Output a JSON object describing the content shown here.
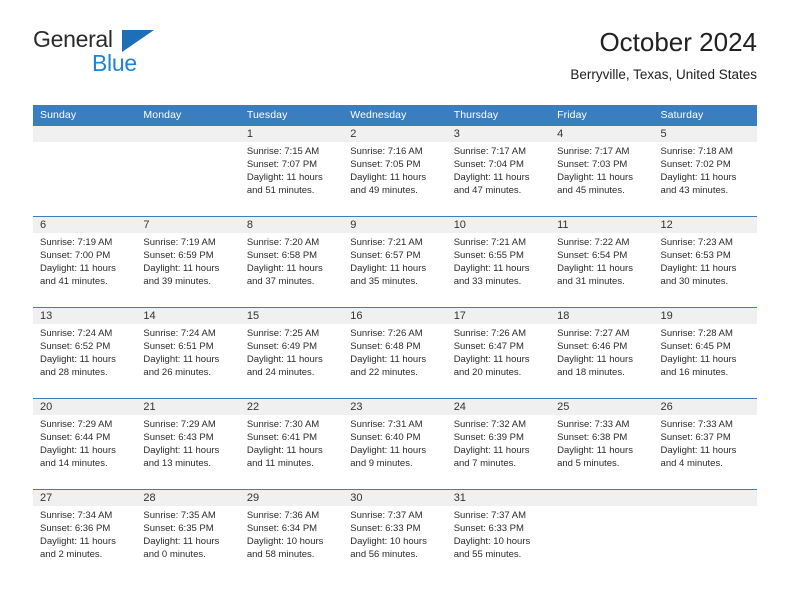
{
  "brand": {
    "name_part1": "General",
    "name_part2": "Blue",
    "triangle_color": "#1f6fb8",
    "blue_color": "#1f83d6"
  },
  "header": {
    "title": "October 2024",
    "subtitle": "Berryville, Texas, United States"
  },
  "colors": {
    "header_blue": "#3a7ebf",
    "daynum_bg": "#f0f0f0",
    "text": "#2b2b2b"
  },
  "calendar": {
    "weekday_headers": [
      "Sunday",
      "Monday",
      "Tuesday",
      "Wednesday",
      "Thursday",
      "Friday",
      "Saturday"
    ],
    "weeks": [
      [
        {
          "day": "",
          "sunrise": "",
          "sunset": "",
          "daylight_line1": "",
          "daylight_line2": ""
        },
        {
          "day": "",
          "sunrise": "",
          "sunset": "",
          "daylight_line1": "",
          "daylight_line2": ""
        },
        {
          "day": "1",
          "sunrise": "Sunrise: 7:15 AM",
          "sunset": "Sunset: 7:07 PM",
          "daylight_line1": "Daylight: 11 hours",
          "daylight_line2": "and 51 minutes."
        },
        {
          "day": "2",
          "sunrise": "Sunrise: 7:16 AM",
          "sunset": "Sunset: 7:05 PM",
          "daylight_line1": "Daylight: 11 hours",
          "daylight_line2": "and 49 minutes."
        },
        {
          "day": "3",
          "sunrise": "Sunrise: 7:17 AM",
          "sunset": "Sunset: 7:04 PM",
          "daylight_line1": "Daylight: 11 hours",
          "daylight_line2": "and 47 minutes."
        },
        {
          "day": "4",
          "sunrise": "Sunrise: 7:17 AM",
          "sunset": "Sunset: 7:03 PM",
          "daylight_line1": "Daylight: 11 hours",
          "daylight_line2": "and 45 minutes."
        },
        {
          "day": "5",
          "sunrise": "Sunrise: 7:18 AM",
          "sunset": "Sunset: 7:02 PM",
          "daylight_line1": "Daylight: 11 hours",
          "daylight_line2": "and 43 minutes."
        }
      ],
      [
        {
          "day": "6",
          "sunrise": "Sunrise: 7:19 AM",
          "sunset": "Sunset: 7:00 PM",
          "daylight_line1": "Daylight: 11 hours",
          "daylight_line2": "and 41 minutes."
        },
        {
          "day": "7",
          "sunrise": "Sunrise: 7:19 AM",
          "sunset": "Sunset: 6:59 PM",
          "daylight_line1": "Daylight: 11 hours",
          "daylight_line2": "and 39 minutes."
        },
        {
          "day": "8",
          "sunrise": "Sunrise: 7:20 AM",
          "sunset": "Sunset: 6:58 PM",
          "daylight_line1": "Daylight: 11 hours",
          "daylight_line2": "and 37 minutes."
        },
        {
          "day": "9",
          "sunrise": "Sunrise: 7:21 AM",
          "sunset": "Sunset: 6:57 PM",
          "daylight_line1": "Daylight: 11 hours",
          "daylight_line2": "and 35 minutes."
        },
        {
          "day": "10",
          "sunrise": "Sunrise: 7:21 AM",
          "sunset": "Sunset: 6:55 PM",
          "daylight_line1": "Daylight: 11 hours",
          "daylight_line2": "and 33 minutes."
        },
        {
          "day": "11",
          "sunrise": "Sunrise: 7:22 AM",
          "sunset": "Sunset: 6:54 PM",
          "daylight_line1": "Daylight: 11 hours",
          "daylight_line2": "and 31 minutes."
        },
        {
          "day": "12",
          "sunrise": "Sunrise: 7:23 AM",
          "sunset": "Sunset: 6:53 PM",
          "daylight_line1": "Daylight: 11 hours",
          "daylight_line2": "and 30 minutes."
        }
      ],
      [
        {
          "day": "13",
          "sunrise": "Sunrise: 7:24 AM",
          "sunset": "Sunset: 6:52 PM",
          "daylight_line1": "Daylight: 11 hours",
          "daylight_line2": "and 28 minutes."
        },
        {
          "day": "14",
          "sunrise": "Sunrise: 7:24 AM",
          "sunset": "Sunset: 6:51 PM",
          "daylight_line1": "Daylight: 11 hours",
          "daylight_line2": "and 26 minutes."
        },
        {
          "day": "15",
          "sunrise": "Sunrise: 7:25 AM",
          "sunset": "Sunset: 6:49 PM",
          "daylight_line1": "Daylight: 11 hours",
          "daylight_line2": "and 24 minutes."
        },
        {
          "day": "16",
          "sunrise": "Sunrise: 7:26 AM",
          "sunset": "Sunset: 6:48 PM",
          "daylight_line1": "Daylight: 11 hours",
          "daylight_line2": "and 22 minutes."
        },
        {
          "day": "17",
          "sunrise": "Sunrise: 7:26 AM",
          "sunset": "Sunset: 6:47 PM",
          "daylight_line1": "Daylight: 11 hours",
          "daylight_line2": "and 20 minutes."
        },
        {
          "day": "18",
          "sunrise": "Sunrise: 7:27 AM",
          "sunset": "Sunset: 6:46 PM",
          "daylight_line1": "Daylight: 11 hours",
          "daylight_line2": "and 18 minutes."
        },
        {
          "day": "19",
          "sunrise": "Sunrise: 7:28 AM",
          "sunset": "Sunset: 6:45 PM",
          "daylight_line1": "Daylight: 11 hours",
          "daylight_line2": "and 16 minutes."
        }
      ],
      [
        {
          "day": "20",
          "sunrise": "Sunrise: 7:29 AM",
          "sunset": "Sunset: 6:44 PM",
          "daylight_line1": "Daylight: 11 hours",
          "daylight_line2": "and 14 minutes."
        },
        {
          "day": "21",
          "sunrise": "Sunrise: 7:29 AM",
          "sunset": "Sunset: 6:43 PM",
          "daylight_line1": "Daylight: 11 hours",
          "daylight_line2": "and 13 minutes."
        },
        {
          "day": "22",
          "sunrise": "Sunrise: 7:30 AM",
          "sunset": "Sunset: 6:41 PM",
          "daylight_line1": "Daylight: 11 hours",
          "daylight_line2": "and 11 minutes."
        },
        {
          "day": "23",
          "sunrise": "Sunrise: 7:31 AM",
          "sunset": "Sunset: 6:40 PM",
          "daylight_line1": "Daylight: 11 hours",
          "daylight_line2": "and 9 minutes."
        },
        {
          "day": "24",
          "sunrise": "Sunrise: 7:32 AM",
          "sunset": "Sunset: 6:39 PM",
          "daylight_line1": "Daylight: 11 hours",
          "daylight_line2": "and 7 minutes."
        },
        {
          "day": "25",
          "sunrise": "Sunrise: 7:33 AM",
          "sunset": "Sunset: 6:38 PM",
          "daylight_line1": "Daylight: 11 hours",
          "daylight_line2": "and 5 minutes."
        },
        {
          "day": "26",
          "sunrise": "Sunrise: 7:33 AM",
          "sunset": "Sunset: 6:37 PM",
          "daylight_line1": "Daylight: 11 hours",
          "daylight_line2": "and 4 minutes."
        }
      ],
      [
        {
          "day": "27",
          "sunrise": "Sunrise: 7:34 AM",
          "sunset": "Sunset: 6:36 PM",
          "daylight_line1": "Daylight: 11 hours",
          "daylight_line2": "and 2 minutes."
        },
        {
          "day": "28",
          "sunrise": "Sunrise: 7:35 AM",
          "sunset": "Sunset: 6:35 PM",
          "daylight_line1": "Daylight: 11 hours",
          "daylight_line2": "and 0 minutes."
        },
        {
          "day": "29",
          "sunrise": "Sunrise: 7:36 AM",
          "sunset": "Sunset: 6:34 PM",
          "daylight_line1": "Daylight: 10 hours",
          "daylight_line2": "and 58 minutes."
        },
        {
          "day": "30",
          "sunrise": "Sunrise: 7:37 AM",
          "sunset": "Sunset: 6:33 PM",
          "daylight_line1": "Daylight: 10 hours",
          "daylight_line2": "and 56 minutes."
        },
        {
          "day": "31",
          "sunrise": "Sunrise: 7:37 AM",
          "sunset": "Sunset: 6:33 PM",
          "daylight_line1": "Daylight: 10 hours",
          "daylight_line2": "and 55 minutes."
        },
        {
          "day": "",
          "sunrise": "",
          "sunset": "",
          "daylight_line1": "",
          "daylight_line2": ""
        },
        {
          "day": "",
          "sunrise": "",
          "sunset": "",
          "daylight_line1": "",
          "daylight_line2": ""
        }
      ]
    ]
  }
}
